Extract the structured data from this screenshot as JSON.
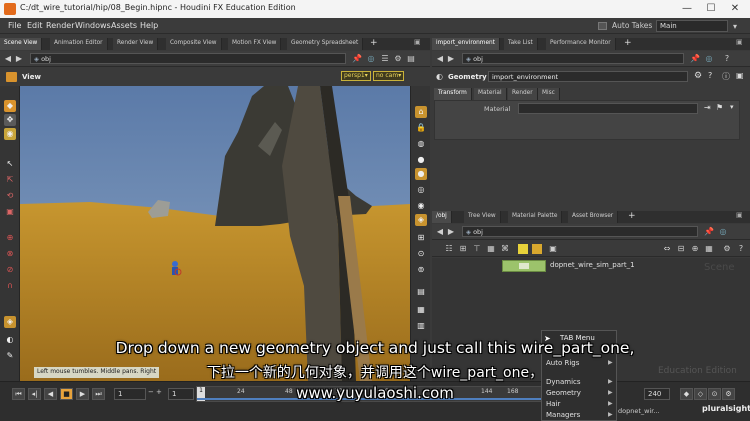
{
  "window": {
    "title": "C:/dt_wire_tutorial/hip/08_Begin.hipnc - Houdini FX Education Edition",
    "minimize": "—",
    "maximize": "☐",
    "close": "✕"
  },
  "menubar": {
    "items": [
      "File",
      "Edit",
      "Render",
      "Windows",
      "Assets",
      "Help"
    ],
    "auto_takes": "Auto Takes",
    "desktop": "Main"
  },
  "left_tabs": [
    "Scene View",
    "Animation Editor",
    "Render View",
    "Composite View",
    "Motion FX View",
    "Geometry Spreadsheet"
  ],
  "left_path": "obj",
  "viewport": {
    "title": "View",
    "persp": "persp1▾",
    "cam": "no cam▾"
  },
  "param_tabs": [
    "import_environment",
    "Take List",
    "Performance Monitor"
  ],
  "param_path": "obj",
  "param": {
    "type": "Geometry",
    "name": "import_environment",
    "subtabs": [
      "Transform",
      "Material",
      "Render",
      "Misc"
    ],
    "material_label": "Material"
  },
  "net_tabs": [
    "/obj",
    "Tree View",
    "Material Palette",
    "Asset Browser"
  ],
  "net_path": "obj",
  "network": {
    "node_name": "dopnet_wire_sim_part_1",
    "watermark_top": "Scene",
    "watermark_bottom": "Education Edition",
    "partial_node": "dopnet_wir..."
  },
  "status_text": "Left mouse tumbles. Middle pans. Right",
  "timeline": {
    "frame": "1",
    "start": "1",
    "ticks": [
      "1",
      "24",
      "48",
      "72",
      "96",
      "120",
      "144",
      "168"
    ],
    "end": "240"
  },
  "tab_menu": {
    "title": "TAB Menu",
    "items": [
      "Auto Rigs",
      "Dynamics",
      "Geometry",
      "Hair",
      "Managers"
    ]
  },
  "subtitles": {
    "english": "Drop down a new geometry object and just call this wire_part_one,",
    "chinese": "下拉一个新的几何对象，并调用这个wire_part_one，",
    "website": "www.yuyulaoshi.com"
  },
  "brand": "pluralsight",
  "colors": {
    "accent_orange": "#e8a33c",
    "sky": "#6e8ab2",
    "ground": "#b8862a",
    "node_green": "#9cc36b"
  }
}
